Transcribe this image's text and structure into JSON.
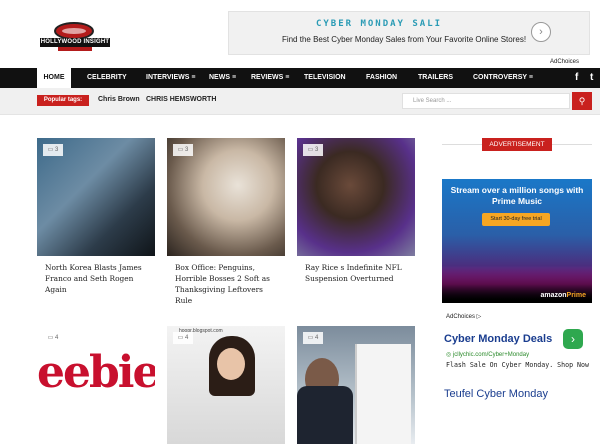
{
  "header": {
    "logo_text": "HOLLYWOOD INSIGHT",
    "ad": {
      "headline": "CYBER MONDAY SALI",
      "subline": "Find the Best Cyber Monday Sales from Your Favorite Online Stores!",
      "adchoices": "AdChoices"
    }
  },
  "nav": {
    "items": [
      {
        "label": "Home",
        "active": true
      },
      {
        "label": "Celebrity"
      },
      {
        "label": "Interviews ≡"
      },
      {
        "label": "News ≡"
      },
      {
        "label": "Reviews ≡"
      },
      {
        "label": "Television"
      },
      {
        "label": "Fashion"
      },
      {
        "label": "Trailers"
      },
      {
        "label": "Controversy ≡"
      }
    ],
    "social": {
      "facebook": "f",
      "twitter": "t"
    }
  },
  "subbar": {
    "badge": "Popular tags:",
    "tags": [
      "Chris Brown",
      "CHRIS HEMSWORTH"
    ],
    "search_placeholder": "Live Search ...",
    "search_icon": "search-icon"
  },
  "posts": [
    {
      "count": "3",
      "title": "North Korea Blasts James Franco and Seth Rogen Again"
    },
    {
      "count": "3",
      "title": "Box Office: Penguins, Horrible Bosses 2 Soft as Thanksgiving Leftovers Rule"
    },
    {
      "count": "3",
      "title": "Ray Rice s Indefinite NFL Suspension Overturned"
    },
    {
      "count": "4",
      "title": ""
    },
    {
      "count": "4",
      "title": ""
    },
    {
      "count": "4",
      "title": ""
    }
  ],
  "thumb_overlays": {
    "post4_text": "eebie",
    "post5_source": "hoopr.blogspot.com"
  },
  "sidebar": {
    "ad_label": "ADVERTISEMENT",
    "prime": {
      "headline": "Stream over a million songs with Prime Music",
      "button": "Start 30-day free trial",
      "brand": "amazon",
      "brand_suffix": "Prime"
    },
    "adchoices": "AdChoices",
    "text_ad": {
      "title": "Cyber Monday Deals",
      "url": "jcllychic.com/Cyber+Monday",
      "desc": "Flash Sale On Cyber Monday. Shop Now",
      "go": "›"
    },
    "second_ad_title": "Teufel Cyber Monday"
  },
  "colors": {
    "accent": "#c9211e",
    "nav_bg": "#111111",
    "link_blue": "#1a3d8f"
  }
}
